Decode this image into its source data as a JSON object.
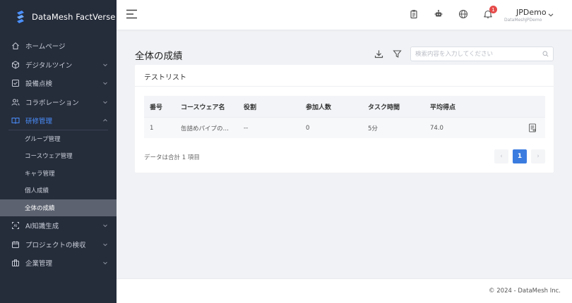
{
  "app": {
    "name": "DataMesh FactVerse"
  },
  "sidebar": {
    "items": [
      {
        "label": "ホームページ",
        "icon": "home-icon",
        "expandable": false
      },
      {
        "label": "デジタルツイン",
        "icon": "cube-icon",
        "expandable": true
      },
      {
        "label": "設備点検",
        "icon": "checklist-icon",
        "expandable": true
      },
      {
        "label": "コラボレーション",
        "icon": "users-icon",
        "expandable": true
      },
      {
        "label": "研修管理",
        "icon": "book-icon",
        "expandable": true,
        "active": true
      },
      {
        "label": "AI知識生成",
        "icon": "ai-icon",
        "expandable": true
      },
      {
        "label": "プロジェクトの検収",
        "icon": "calendar-icon",
        "expandable": true
      },
      {
        "label": "企業管理",
        "icon": "building-icon",
        "expandable": true
      }
    ],
    "training_sub": [
      {
        "label": "グループ管理"
      },
      {
        "label": "コースウェア管理"
      },
      {
        "label": "キャラ管理"
      },
      {
        "label": "個人成績"
      },
      {
        "label": "全体の成績",
        "selected": true
      }
    ]
  },
  "header": {
    "notification_count": "1",
    "user_name": "JPDemo",
    "user_org": "DataMeshJPDemo"
  },
  "page": {
    "title": "全体の成績",
    "search_placeholder": "検索内容を入力してください"
  },
  "card": {
    "title": "テストリスト",
    "columns": [
      "番号",
      "コースウェア名",
      "役割",
      "参加人数",
      "タスク時間",
      "平均得点"
    ],
    "rows": [
      {
        "no": "1",
        "courseware": "缶詰めパイプの…",
        "role": "--",
        "participants": "0",
        "task_time": "5分",
        "avg_score": "74.0"
      }
    ],
    "total_text": "データは合計 1 項目",
    "pagination": {
      "current": "1",
      "prev": "‹",
      "next": "›"
    }
  },
  "footer": {
    "copyright": "© 2024 - DataMesh Inc."
  },
  "colors": {
    "sidebar_bg": "#252c3a",
    "accent": "#3a7be0",
    "active_menu": "#4a90ff",
    "badge": "#e64a4a"
  }
}
